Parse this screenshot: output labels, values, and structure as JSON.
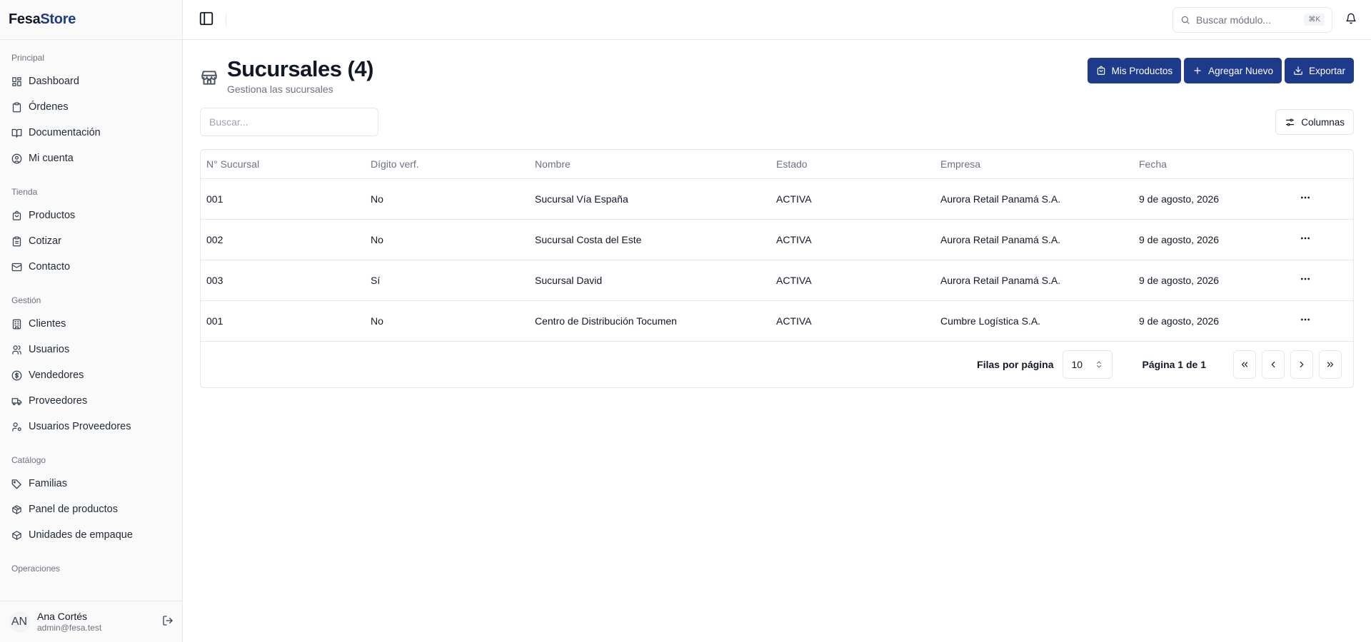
{
  "brand": {
    "part1": "Fesa",
    "part2": "Store"
  },
  "sidebar": {
    "groups": [
      {
        "label": "Principal",
        "items": [
          {
            "label": "Dashboard",
            "icon": "layout-dashboard-icon"
          },
          {
            "label": "Órdenes",
            "icon": "clipboard-icon"
          },
          {
            "label": "Documentación",
            "icon": "book-open-icon"
          },
          {
            "label": "Mi cuenta",
            "icon": "user-circle-icon"
          }
        ]
      },
      {
        "label": "Tienda",
        "items": [
          {
            "label": "Productos",
            "icon": "shopping-bag-icon"
          },
          {
            "label": "Cotizar",
            "icon": "clipboard-list-icon"
          },
          {
            "label": "Contacto",
            "icon": "mail-icon"
          }
        ]
      },
      {
        "label": "Gestión",
        "items": [
          {
            "label": "Clientes",
            "icon": "building-icon"
          },
          {
            "label": "Usuarios",
            "icon": "users-icon"
          },
          {
            "label": "Vendedores",
            "icon": "badge-dollar-icon"
          },
          {
            "label": "Proveedores",
            "icon": "truck-icon"
          },
          {
            "label": "Usuarios Proveedores",
            "icon": "user-cog-icon"
          }
        ]
      },
      {
        "label": "Catálogo",
        "items": [
          {
            "label": "Familias",
            "icon": "tags-icon"
          },
          {
            "label": "Panel de productos",
            "icon": "package-icon"
          },
          {
            "label": "Unidades de empaque",
            "icon": "box-icon"
          }
        ]
      },
      {
        "label": "Operaciones",
        "items": []
      }
    ]
  },
  "user": {
    "initials": "AN",
    "name": "Ana Cortés",
    "email": "admin@fesa.test"
  },
  "topbar": {
    "search_placeholder": "Buscar módulo...",
    "shortcut": "⌘K"
  },
  "page": {
    "title": "Sucursales (4)",
    "subtitle": "Gestiona las sucursales"
  },
  "actions": {
    "my_products": "Mis Productos",
    "add_new": "Agregar Nuevo",
    "export": "Exportar"
  },
  "filter": {
    "search_placeholder": "Buscar...",
    "columns_label": "Columnas"
  },
  "table": {
    "headers": [
      "N° Sucursal",
      "Dígito verf.",
      "Nombre",
      "Estado",
      "Empresa",
      "Fecha"
    ],
    "rows": [
      [
        "001",
        "No",
        "Sucursal Vía España",
        "ACTIVA",
        "Aurora Retail Panamá S.A.",
        "9 de agosto, 2026"
      ],
      [
        "002",
        "No",
        "Sucursal Costa del Este",
        "ACTIVA",
        "Aurora Retail Panamá S.A.",
        "9 de agosto, 2026"
      ],
      [
        "003",
        "Sí",
        "Sucursal David",
        "ACTIVA",
        "Aurora Retail Panamá S.A.",
        "9 de agosto, 2026"
      ],
      [
        "001",
        "No",
        "Centro de Distribución Tocumen",
        "ACTIVA",
        "Cumbre Logística S.A.",
        "9 de agosto, 2026"
      ]
    ]
  },
  "pagination": {
    "rows_label": "Filas por página",
    "page_size": "10",
    "page_info": "Página 1 de 1"
  },
  "colors": {
    "accent": "#1e3a8a",
    "border": "#e5e7eb",
    "muted_text": "#6b7280"
  }
}
